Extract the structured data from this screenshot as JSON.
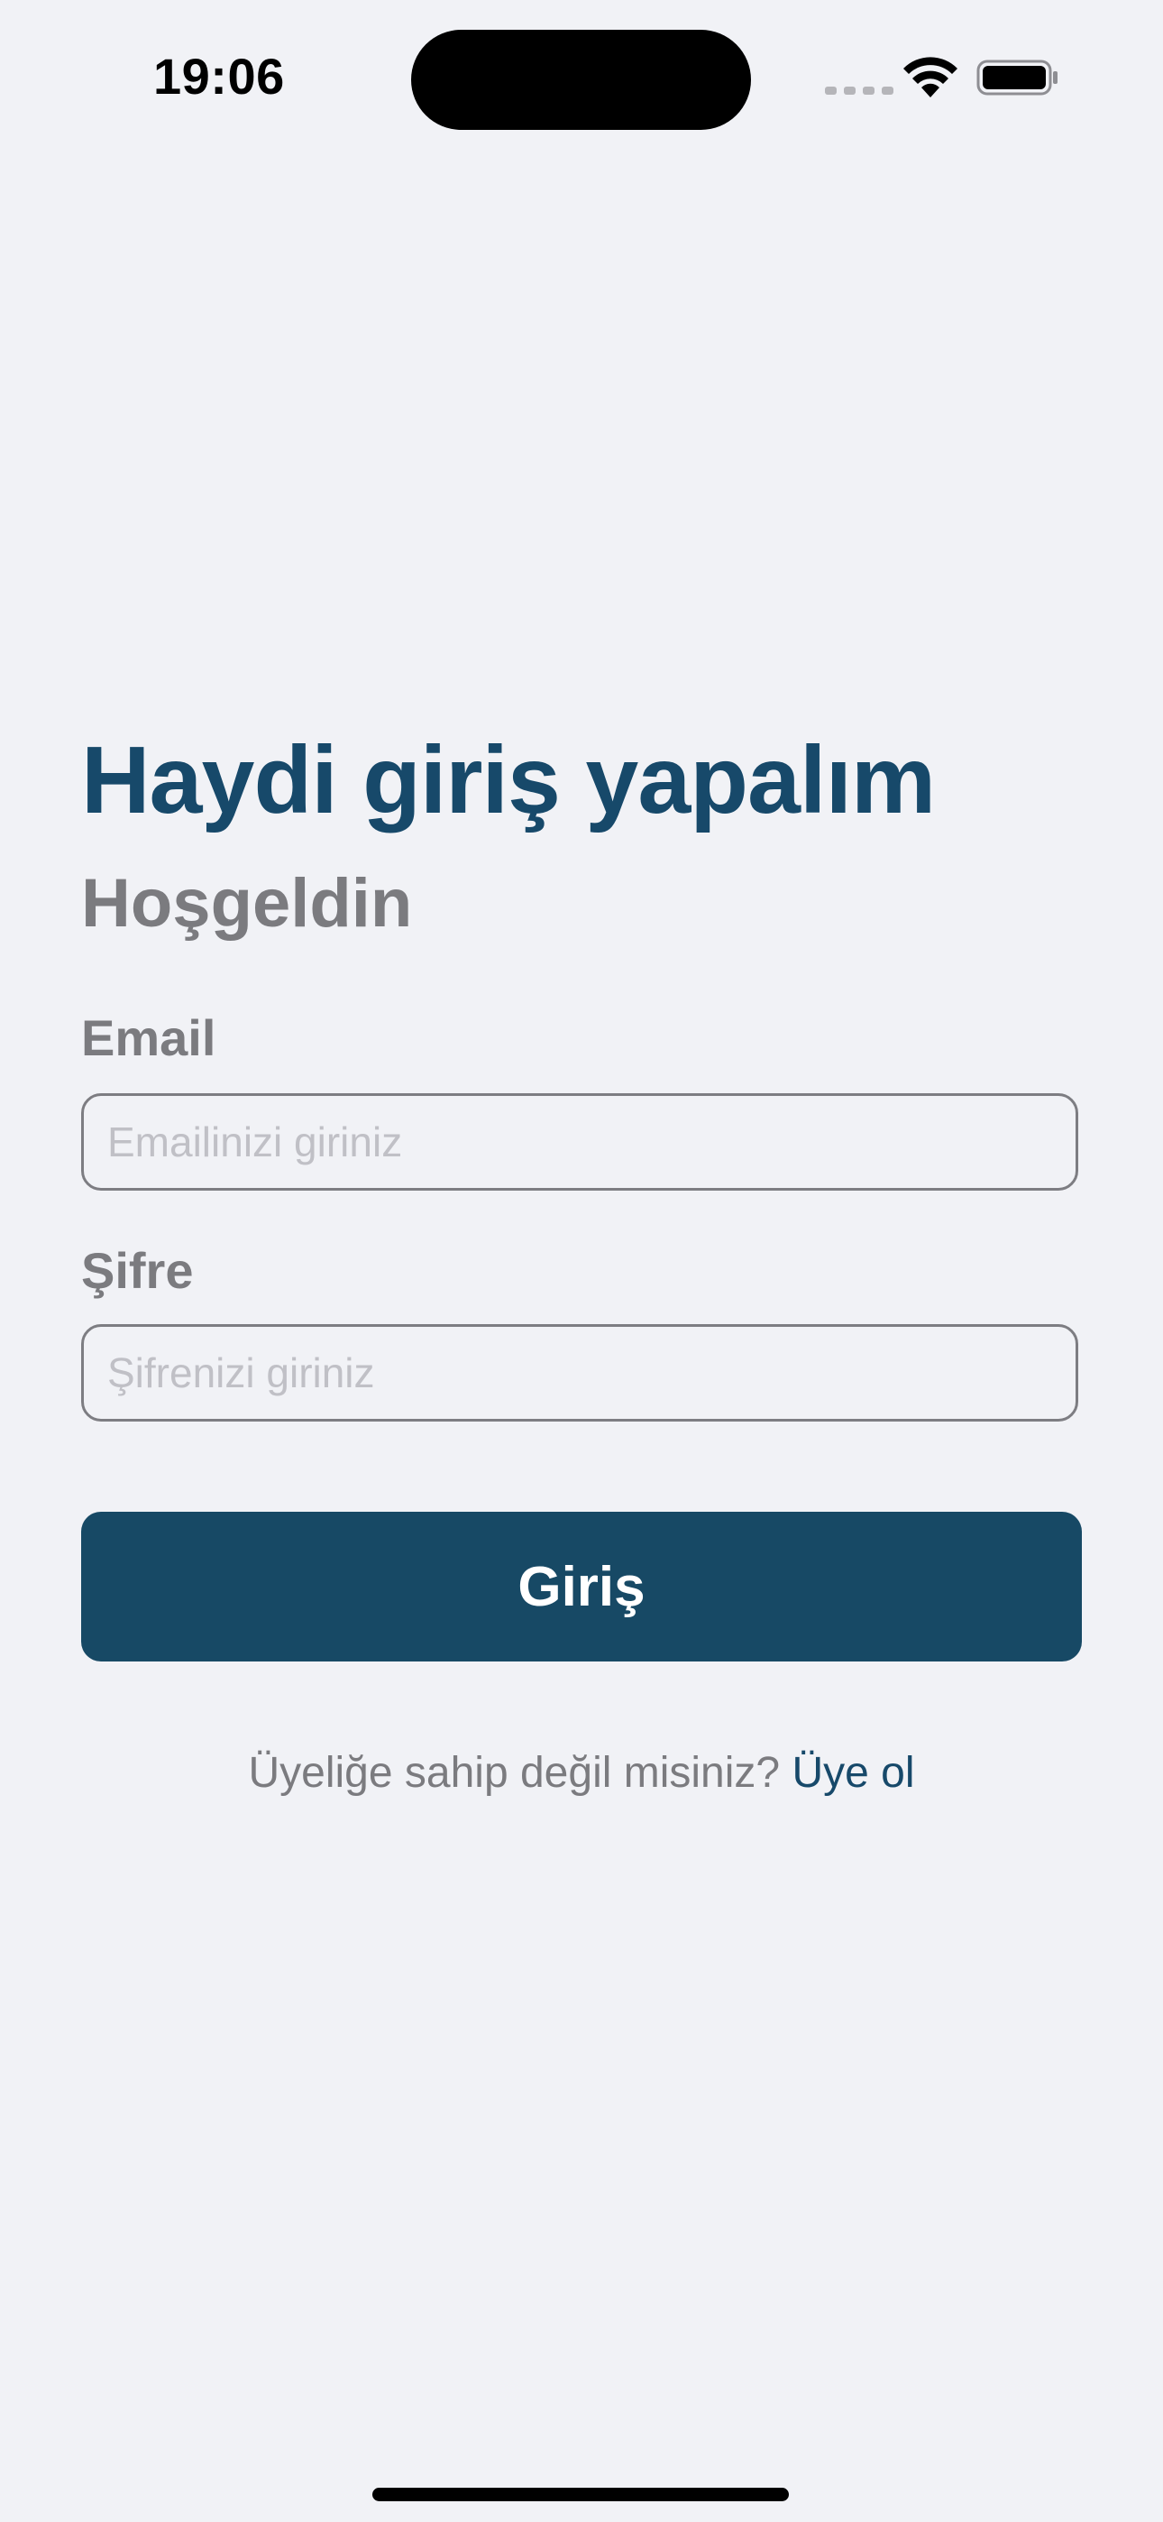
{
  "status_bar": {
    "time": "19:06",
    "icons": [
      "cellular-signal-icon",
      "wifi-icon",
      "battery-icon"
    ]
  },
  "login": {
    "title": "Haydi giriş yapalım",
    "subtitle": "Hoşgeldin",
    "email_label": "Email",
    "email_placeholder": "Emailinizi giriniz",
    "password_label": "Şifre",
    "password_placeholder": "Şifrenizi giriniz",
    "submit_label": "Giriş",
    "signup_prompt": "Üyeliğe sahip değil misiniz?",
    "signup_link": "Üye ol"
  },
  "colors": {
    "background": "#f1f2f6",
    "primary": "#174965",
    "title": "#17496a",
    "muted_text": "#7b7b7f",
    "placeholder": "#c0c0c6"
  }
}
